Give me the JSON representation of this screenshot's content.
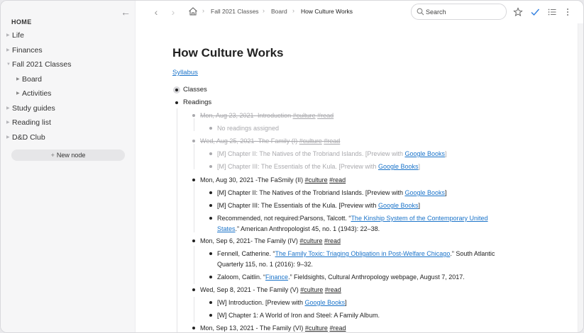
{
  "sidebar": {
    "home_label": "HOME",
    "items": [
      {
        "label": "Life",
        "expanded": false
      },
      {
        "label": "Finances",
        "expanded": false
      },
      {
        "label": "Fall 2021 Classes",
        "expanded": true
      },
      {
        "label": "Board",
        "expanded": false
      },
      {
        "label": "Activities",
        "expanded": false
      },
      {
        "label": "Study guides",
        "expanded": false
      },
      {
        "label": "Reading list",
        "expanded": false
      },
      {
        "label": "D&D Club",
        "expanded": false
      }
    ],
    "new_node_label": "New node"
  },
  "breadcrumb": {
    "items": [
      "Fall 2021 Classes",
      "Board",
      "How Culture Works"
    ]
  },
  "search": {
    "placeholder": "Search"
  },
  "toolbar": {
    "icons": [
      "star-icon",
      "checkmark-icon",
      "list-icon",
      "more-icon"
    ],
    "check_color": "#2f7fe0"
  },
  "document": {
    "title": "How Culture Works",
    "syllabus_link": "Syllabus",
    "classes_label": "Classes",
    "readings_label": "Readings",
    "entries": [
      {
        "text": "Mon, Aug 23, 2021- Introduction ",
        "tags": [
          "#culture",
          "#read"
        ],
        "state": "done"
      },
      {
        "child": "No readings assigned",
        "state": "faded"
      },
      {
        "text": "Wed, Aug 25, 2021- The Family (I) ",
        "tags": [
          "#culture",
          "#read"
        ],
        "state": "done"
      },
      {
        "child_pre": "[M] Chapter II: The Natives of the Trobriand Islands. [Preview with ",
        "child_link": "Google Books",
        "child_post": "]",
        "state": "faded"
      },
      {
        "child_pre": "[M] Chapter III: The Essentials of the Kula. [Preview with ",
        "child_link": "Google Books",
        "child_post": "]",
        "state": "faded"
      },
      {
        "text": "Mon, Aug 30, 2021 -The FaSmily (II) ",
        "tags": [
          "#culture",
          "#read"
        ],
        "state": "normal"
      },
      {
        "child_pre": "[M] Chapter II: The Natives of the Trobriand Islands. [Preview with ",
        "child_link": "Google Books",
        "child_post": "]",
        "state": "normal"
      },
      {
        "child_pre": "[M] Chapter III: The Essentials of the Kula. [Preview with ",
        "child_link": "Google Books",
        "child_post": "]",
        "state": "normal"
      },
      {
        "child_pre": "Recommended, not required:Parsons, Talcott. “",
        "child_link": "The Kinship System of the Contemporary United",
        "child_link2": "States",
        "child_post": ".” American Anthropologist 45, no. 1 (1943): 22–38.",
        "state": "normal"
      },
      {
        "text": "Mon, Sep 6, 2021- The Family (IV) ",
        "tags": [
          "#culture",
          "#read"
        ],
        "state": "normal"
      },
      {
        "child_pre": "Fennell, Catherine. “",
        "child_link": "The Family Toxic: Triaging Obligation in Post-Welfare Chicago",
        "child_post": ".” South Atlantic",
        "child_line2": "Quarterly 115, no. 1 (2016): 9–32.",
        "state": "normal"
      },
      {
        "child_pre": "Zaloom, Caitlin. “",
        "child_link": "Finance",
        "child_post": ".” Fieldsights, Cultural Anthropology webpage, August 7, 2017.",
        "state": "normal"
      },
      {
        "text": "Wed, Sep 8, 2021 - The Family (V) ",
        "tags": [
          "#culture",
          "#read"
        ],
        "state": "normal"
      },
      {
        "child_pre": "[W] Introduction. [Preview with ",
        "child_link": "Google Books",
        "child_post": "]",
        "state": "normal"
      },
      {
        "child": "[W] Chapter 1: A World of Iron and Steel: A Family Album.",
        "state": "normal"
      },
      {
        "text": "Mon, Sep 13, 2021 - The Family (VI) ",
        "tags": [
          "#culture",
          "#read"
        ],
        "state": "normal"
      }
    ]
  }
}
